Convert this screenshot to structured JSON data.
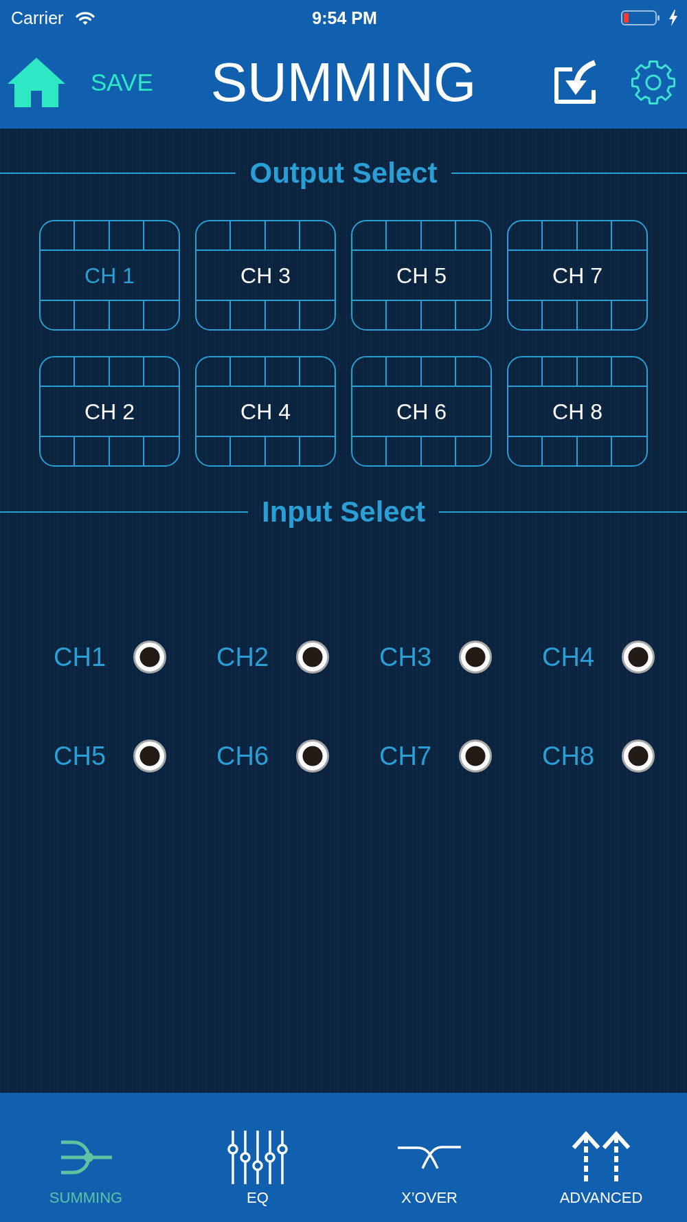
{
  "status_bar": {
    "carrier": "Carrier",
    "time": "9:54 PM"
  },
  "header": {
    "save": "SAVE",
    "title": "SUMMING"
  },
  "output_select": {
    "heading": "Output Select",
    "channels": [
      {
        "label": "CH 1",
        "selected": true
      },
      {
        "label": "CH 3",
        "selected": false
      },
      {
        "label": "CH 5",
        "selected": false
      },
      {
        "label": "CH 7",
        "selected": false
      },
      {
        "label": "CH 2",
        "selected": false
      },
      {
        "label": "CH 4",
        "selected": false
      },
      {
        "label": "CH 6",
        "selected": false
      },
      {
        "label": "CH 8",
        "selected": false
      }
    ]
  },
  "input_select": {
    "heading": "Input Select",
    "channels": [
      {
        "label": "CH1",
        "selected": false
      },
      {
        "label": "CH2",
        "selected": false
      },
      {
        "label": "CH3",
        "selected": false
      },
      {
        "label": "CH4",
        "selected": false
      },
      {
        "label": "CH5",
        "selected": false
      },
      {
        "label": "CH6",
        "selected": false
      },
      {
        "label": "CH7",
        "selected": false
      },
      {
        "label": "CH8",
        "selected": false
      }
    ]
  },
  "tab_bar": {
    "tabs": [
      {
        "kind": "summing",
        "label": "SUMMING",
        "selected": true
      },
      {
        "kind": "eq",
        "label": "EQ",
        "selected": false
      },
      {
        "kind": "crossover",
        "label": "X’OVER",
        "selected": false
      },
      {
        "kind": "advanced",
        "label": "ADVANCED",
        "selected": false
      }
    ]
  }
}
